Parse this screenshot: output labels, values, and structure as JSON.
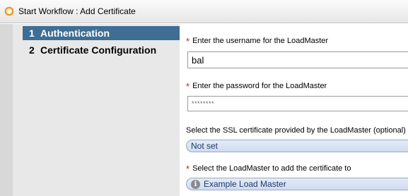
{
  "window": {
    "title": "Start Workflow : Add Certificate"
  },
  "steps": [
    {
      "number": "1",
      "label": "Authentication",
      "active": true
    },
    {
      "number": "2",
      "label": "Certificate Configuration",
      "active": false
    }
  ],
  "form": {
    "username": {
      "label": "Enter the username for the LoadMaster",
      "required": true,
      "value": "bal"
    },
    "password": {
      "label": "Enter the password for the LoadMaster",
      "required": true,
      "value": "********"
    },
    "ssl_certificate": {
      "label": "Select the SSL certificate provided by the LoadMaster (optional)",
      "required": false,
      "selected": "Not set"
    },
    "loadmaster": {
      "label": "Select the LoadMaster to add the certificate to",
      "required": true,
      "selected": "Example Load Master",
      "icon": "info-icon"
    }
  },
  "colors": {
    "active_step_bg": "#3e6e93",
    "required_asterisk": "#d01818",
    "select_bg": "#dbe5f3"
  }
}
